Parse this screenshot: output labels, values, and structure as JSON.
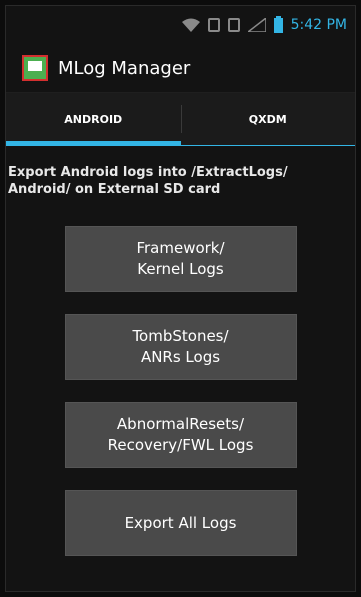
{
  "status_bar": {
    "time": "5:42 PM",
    "icons": [
      "wifi-icon",
      "vibrate-icon",
      "sim-icon",
      "signal-icon",
      "battery-icon"
    ]
  },
  "app": {
    "title": "MLog Manager",
    "icon": "app-icon"
  },
  "tabs": [
    {
      "label": "ANDROID",
      "active": true
    },
    {
      "label": "QXDM",
      "active": false
    }
  ],
  "description": "Export Android logs into /ExtractLogs/ Android/ on External SD card",
  "buttons": [
    {
      "label": "Framework/\nKernel Logs"
    },
    {
      "label": "TombStones/\nANRs Logs"
    },
    {
      "label": "AbnormalResets/\nRecovery/FWL Logs"
    },
    {
      "label": "Export All Logs"
    }
  ],
  "colors": {
    "accent": "#33b5e5",
    "button_bg": "#4a4a4a",
    "background": "#131313"
  }
}
